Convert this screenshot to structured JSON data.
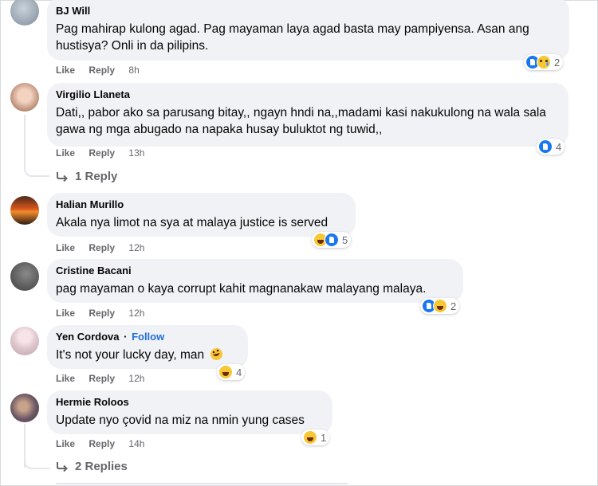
{
  "comments": [
    {
      "author": "BJ Will",
      "text": "Pag mahirap kulong agad. Pag mayaman laya agad basta may pampiyensa. Asan ang hustisya? Onli in da pilipins.",
      "like_label": "Like",
      "reply_label": "Reply",
      "time": "8h",
      "reactions": [
        "like",
        "sad"
      ],
      "reaction_count": "2"
    },
    {
      "author": "Virgilio Llaneta",
      "text": "Dati,, pabor ako sa parusang bitay,, ngayn hndi na,,madami kasi nakukulong na wala sala gawa ng mga abugado na napaka husay buluktot ng tuwid,,",
      "like_label": "Like",
      "reply_label": "Reply",
      "time": "13h",
      "reactions": [
        "like"
      ],
      "reaction_count": "4",
      "replies_label": "1 Reply"
    },
    {
      "author": "Halian Murillo",
      "text": "Akala nya limot na sya at malaya justice is served",
      "like_label": "Like",
      "reply_label": "Reply",
      "time": "12h",
      "reactions": [
        "haha",
        "like"
      ],
      "reaction_count": "5"
    },
    {
      "author": "Cristine Bacani",
      "text": "pag mayaman o kaya corrupt kahit magnanakaw malayang malaya.",
      "like_label": "Like",
      "reply_label": "Reply",
      "time": "12h",
      "reactions": [
        "like",
        "haha"
      ],
      "reaction_count": "2"
    },
    {
      "author": "Yen Cordova",
      "follow_label": "Follow",
      "text": "It's not your lucky day, man",
      "like_label": "Like",
      "reply_label": "Reply",
      "time": "12h",
      "reactions": [
        "haha"
      ],
      "reaction_count": "4"
    },
    {
      "author": "Hermie Roloos",
      "text": "Update nyo çovid na miz na nmin yung cases",
      "like_label": "Like",
      "reply_label": "Reply",
      "time": "14h",
      "reactions": [
        "haha"
      ],
      "reaction_count": "1",
      "replies_label": "2 Replies"
    }
  ],
  "colors": {
    "bubble": "#f0f2f5",
    "link": "#216fdb",
    "meta": "#65676b",
    "like": "#1877f2",
    "haha": "#f7c735"
  },
  "icons": {
    "like": "like-reaction-icon",
    "haha": "haha-reaction-icon",
    "sad": "sad-reaction-icon",
    "reply": "reply-arrow-icon",
    "laugh_emoji": "rolling-laughing-emoji-icon"
  }
}
